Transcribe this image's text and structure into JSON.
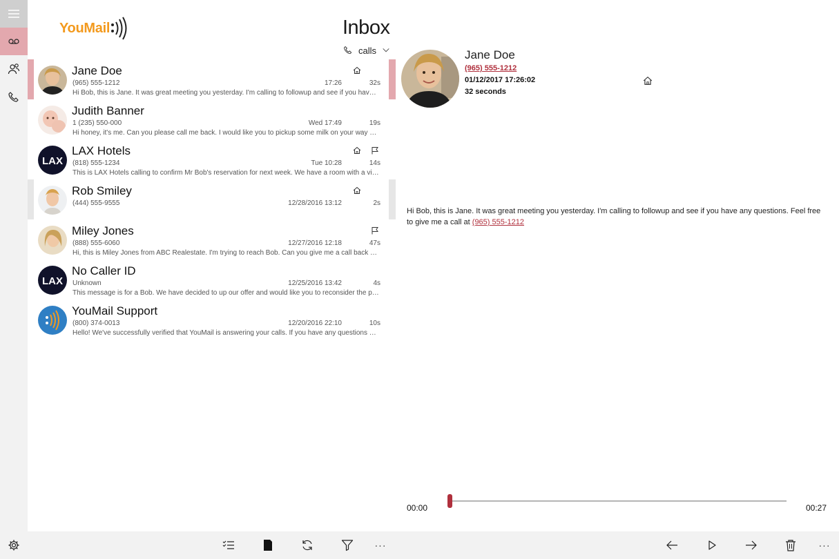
{
  "app": {
    "logo_text": "YouMail",
    "page_title": "Inbox",
    "filter_label": "calls"
  },
  "nav": [
    {
      "name": "menu"
    },
    {
      "name": "voicemail"
    },
    {
      "name": "contacts"
    },
    {
      "name": "calls"
    },
    {
      "name": "settings"
    }
  ],
  "messages": [
    {
      "name": "Jane Doe",
      "phone": "(965) 555-1212",
      "when": "17:26",
      "duration": "32s",
      "preview": "Hi Bob, this is Jane. It was great meeting you yesterday. I'm calling to followup and see if you have any questions.",
      "home": true,
      "flag": false,
      "avatar": "photo-woman-blonde"
    },
    {
      "name": "Judith Banner",
      "phone": "1 (235) 550-000",
      "when": "Wed 17:49",
      "duration": "19s",
      "preview": "Hi honey, it's me. Can you please call me back. I would like you to pickup some milk on your way home.",
      "home": false,
      "flag": false,
      "avatar": "photo-baby"
    },
    {
      "name": "LAX Hotels",
      "phone": "(818) 555-1234",
      "when": "Tue 10:28",
      "duration": "14s",
      "preview": "This is LAX Hotels calling to confirm Mr Bob's reservation for next week. We have a room with a view.",
      "home": true,
      "flag": true,
      "avatar": "lax-logo"
    },
    {
      "name": "Rob Smiley",
      "phone": "(444) 555-9555",
      "when": "12/28/2016 13:12",
      "duration": "2s",
      "preview": "",
      "home": true,
      "flag": false,
      "avatar": "photo-man"
    },
    {
      "name": "Miley Jones",
      "phone": "(888) 555-6060",
      "when": "12/27/2016 12:18",
      "duration": "47s",
      "preview": "Hi, this is Miley Jones from ABC Realestate. I'm trying to reach Bob. Can you give me a call back on my cell.",
      "home": false,
      "flag": true,
      "avatar": "photo-woman"
    },
    {
      "name": "No Caller ID",
      "phone": "Unknown",
      "when": "12/25/2016 13:42",
      "duration": "4s",
      "preview": "This message is for a Bob. We have decided to up our offer and would like you to reconsider the proposal.",
      "home": false,
      "flag": false,
      "avatar": "lax-logo"
    },
    {
      "name": "YouMail Support",
      "phone": "(800) 374-0013",
      "when": "12/20/2016 22:10",
      "duration": "10s",
      "preview": "Hello! We've successfully verified that YouMail is answering your calls. If you have any questions please contact us.",
      "home": false,
      "flag": false,
      "avatar": "youmail-logo"
    }
  ],
  "detail": {
    "name": "Jane Doe",
    "phone": "(965) 555-1212",
    "datetime": "01/12/2017 17:26:02",
    "duration": "32 seconds",
    "transcript_before_link": "Hi Bob, this is Jane. It was great meeting you yesterday. I'm calling to followup and see if you have any questions. Feel free to give me a call at ",
    "transcript_link": "(965) 555-1212"
  },
  "player": {
    "current_time": "00:00",
    "total_time": "00:27",
    "progress": 0.0
  },
  "toolbar": {
    "more_label": "···"
  },
  "colors": {
    "accent": "#b0303d",
    "selected": "#e3a8ae",
    "logo_orange": "#f39a1e",
    "chrome": "#f2f2f2"
  }
}
